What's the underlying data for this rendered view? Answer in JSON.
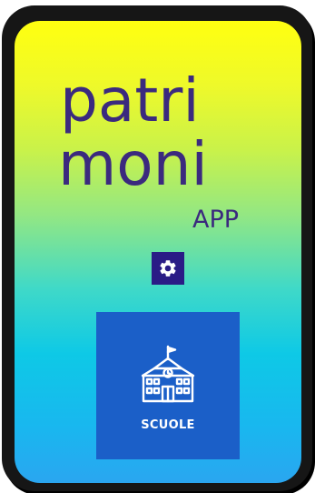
{
  "app": {
    "logo_line1": "patri",
    "logo_line2": "moni",
    "logo_suffix": "APP"
  },
  "settings": {
    "icon": "gear-icon"
  },
  "tiles": [
    {
      "label": "SCUOLE",
      "icon": "school-building-icon"
    }
  ],
  "colors": {
    "logo_text": "#3b2a7e",
    "settings_bg": "#2a1c86",
    "tile_bg": "#1b5fc8",
    "gradient_top": "#ffff10",
    "gradient_bottom": "#2aa6f0",
    "frame": "#161616"
  }
}
